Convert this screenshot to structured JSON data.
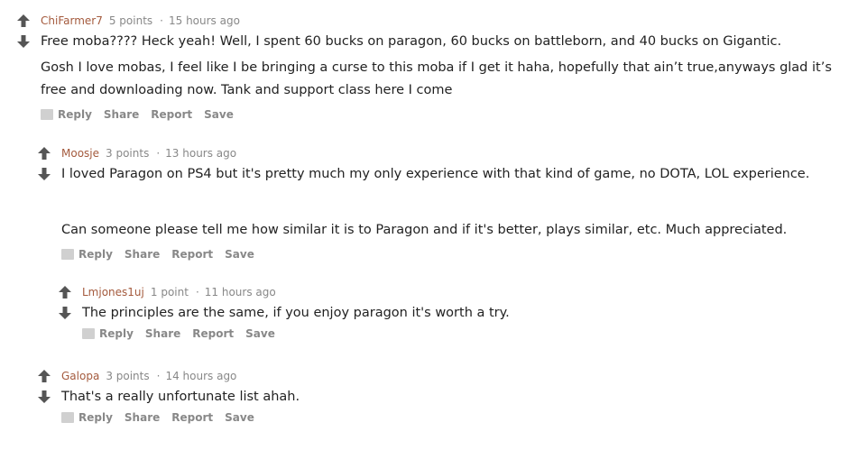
{
  "comments": [
    {
      "author": "ChiFarmer7",
      "points": "5 points",
      "dot": "·",
      "time": "15 hours ago",
      "paragraphs": [
        "Free moba???? Heck yeah! Well, I spent 60 bucks on paragon, 60 bucks on battleborn, and 40 bucks on Gigantic.",
        "Gosh I love mobas, I feel like I be bringing a curse to this moba if I get it haha, hopefully that ain’t true,anyways glad it’s free and downloading now. Tank and support class here I come"
      ],
      "actions": {
        "reply": "Reply",
        "share": "Share",
        "report": "Report",
        "save": "Save"
      }
    },
    {
      "author": "Moosje",
      "points": "3 points",
      "dot": "·",
      "time": "13 hours ago",
      "paragraphs": [
        "I loved Paragon on PS4 but it's pretty much my only experience with that kind of game, no DOTA, LOL experience.",
        "Can someone please tell me how similar it is to Paragon and if it's better, plays similar, etc. Much appreciated."
      ],
      "actions": {
        "reply": "Reply",
        "share": "Share",
        "report": "Report",
        "save": "Save"
      }
    },
    {
      "author": "Lmjones1uj",
      "points": "1 point",
      "dot": "·",
      "time": "11 hours ago",
      "paragraphs": [
        "The principles are the same, if you enjoy paragon it's worth a try."
      ],
      "actions": {
        "reply": "Reply",
        "share": "Share",
        "report": "Report",
        "save": "Save"
      }
    },
    {
      "author": "Galopa",
      "points": "3 points",
      "dot": "·",
      "time": "14 hours ago",
      "paragraphs": [
        "That's a really unfortunate list ahah."
      ],
      "actions": {
        "reply": "Reply",
        "share": "Share",
        "report": "Report",
        "save": "Save"
      }
    }
  ],
  "colors": {
    "author": "#a45a3d",
    "meta": "#888888",
    "vote_arrow": "#555555",
    "text": "#222222"
  },
  "icons": {
    "upvote": "arrow-up-icon",
    "downvote": "arrow-down-icon",
    "reply": "comment-bubble-icon"
  }
}
